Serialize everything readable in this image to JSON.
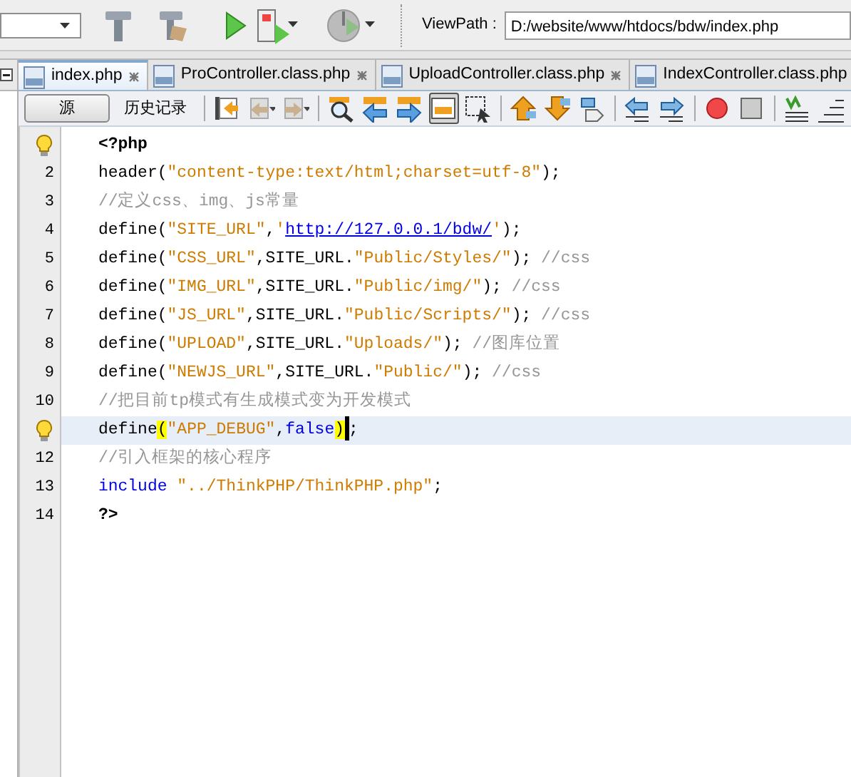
{
  "main_toolbar": {
    "viewpath_label": "ViewPath :",
    "viewpath_value": "D:/website/www/htdocs/bdw/index.php"
  },
  "tabs": [
    {
      "label": "index.php",
      "selected": true
    },
    {
      "label": "ProController.class.php",
      "selected": false
    },
    {
      "label": "UploadController.class.php",
      "selected": false
    },
    {
      "label": "IndexController.class.php",
      "selected": false
    }
  ],
  "editor_toolbar": {
    "views": [
      {
        "label": "源",
        "selected": true
      },
      {
        "label": "历史记录",
        "selected": false
      }
    ],
    "tools": [
      {
        "pressed": false
      },
      {
        "pressed": false
      },
      {
        "pressed": false
      },
      {
        "pressed": false
      },
      {
        "pressed": false
      },
      {
        "pressed": false
      },
      {
        "pressed": true
      },
      {
        "pressed": false
      },
      {
        "pressed": false
      },
      {
        "pressed": false
      },
      {
        "pressed": false
      },
      {
        "pressed": false
      },
      {
        "pressed": false
      },
      {
        "pressed": false
      },
      {
        "pressed": false
      },
      {
        "pressed": false
      },
      {
        "pressed": false
      }
    ]
  },
  "lines": [
    {
      "hint": true,
      "current": false,
      "tokens": [
        {
          "kind": "keyword",
          "text": "<?php"
        }
      ]
    },
    {
      "number": "2",
      "current": false,
      "tokens": [
        {
          "kind": "plain",
          "text": "header("
        },
        {
          "kind": "string",
          "text": "\"content-type:text/html;charset=utf-8\""
        },
        {
          "kind": "plain",
          "text": ");"
        }
      ]
    },
    {
      "number": "3",
      "current": false,
      "tokens": [
        {
          "kind": "comment",
          "text": "//定义css、img、js常量"
        }
      ]
    },
    {
      "number": "4",
      "current": false,
      "tokens": [
        {
          "kind": "plain",
          "text": "define("
        },
        {
          "kind": "string",
          "text": "\"SITE_URL\""
        },
        {
          "kind": "plain",
          "text": ","
        },
        {
          "kind": "string",
          "text": "'"
        },
        {
          "kind": "link",
          "text": "http://127.0.0.1/bdw/"
        },
        {
          "kind": "string",
          "text": "'"
        },
        {
          "kind": "plain",
          "text": ");"
        }
      ]
    },
    {
      "number": "5",
      "current": false,
      "tokens": [
        {
          "kind": "plain",
          "text": "define("
        },
        {
          "kind": "string",
          "text": "\"CSS_URL\""
        },
        {
          "kind": "plain",
          "text": ",SITE_URL."
        },
        {
          "kind": "string",
          "text": "\"Public/Styles/\""
        },
        {
          "kind": "plain",
          "text": "); "
        },
        {
          "kind": "comment",
          "text": "//css"
        }
      ]
    },
    {
      "number": "6",
      "current": false,
      "tokens": [
        {
          "kind": "plain",
          "text": "define("
        },
        {
          "kind": "string",
          "text": "\"IMG_URL\""
        },
        {
          "kind": "plain",
          "text": ",SITE_URL."
        },
        {
          "kind": "string",
          "text": "\"Public/img/\""
        },
        {
          "kind": "plain",
          "text": "); "
        },
        {
          "kind": "comment",
          "text": "//css"
        }
      ]
    },
    {
      "number": "7",
      "current": false,
      "tokens": [
        {
          "kind": "plain",
          "text": "define("
        },
        {
          "kind": "string",
          "text": "\"JS_URL\""
        },
        {
          "kind": "plain",
          "text": ",SITE_URL."
        },
        {
          "kind": "string",
          "text": "\"Public/Scripts/\""
        },
        {
          "kind": "plain",
          "text": "); "
        },
        {
          "kind": "comment",
          "text": "//css"
        }
      ]
    },
    {
      "number": "8",
      "current": false,
      "tokens": [
        {
          "kind": "plain",
          "text": "define("
        },
        {
          "kind": "string",
          "text": "\"UPLOAD\""
        },
        {
          "kind": "plain",
          "text": ",SITE_URL."
        },
        {
          "kind": "string",
          "text": "\"Uploads/\""
        },
        {
          "kind": "plain",
          "text": "); "
        },
        {
          "kind": "comment",
          "text": "//图库位置"
        }
      ]
    },
    {
      "number": "9",
      "current": false,
      "tokens": [
        {
          "kind": "plain",
          "text": "define("
        },
        {
          "kind": "string",
          "text": "\"NEWJS_URL\""
        },
        {
          "kind": "plain",
          "text": ",SITE_URL."
        },
        {
          "kind": "string",
          "text": "\"Public/\""
        },
        {
          "kind": "plain",
          "text": "); "
        },
        {
          "kind": "comment",
          "text": "//css"
        }
      ]
    },
    {
      "number": "10",
      "current": false,
      "tokens": [
        {
          "kind": "comment",
          "text": "//把目前tp模式有生成模式变为开发模式"
        }
      ]
    },
    {
      "hint": true,
      "current": true,
      "tokens": [
        {
          "kind": "plain",
          "text": "define"
        },
        {
          "kind": "match",
          "text": "("
        },
        {
          "kind": "string",
          "text": "\"APP_DEBUG\""
        },
        {
          "kind": "plain",
          "text": ","
        },
        {
          "kind": "literal",
          "text": "false"
        },
        {
          "kind": "match",
          "text": ")"
        },
        {
          "kind": "caret"
        },
        {
          "kind": "plain",
          "text": ";"
        }
      ]
    },
    {
      "number": "12",
      "current": false,
      "tokens": [
        {
          "kind": "comment",
          "text": "//引入框架的核心程序"
        }
      ]
    },
    {
      "number": "13",
      "current": false,
      "tokens": [
        {
          "kind": "literal",
          "text": "include"
        },
        {
          "kind": "string",
          "text": " \"../ThinkPHP/ThinkPHP.php\""
        },
        {
          "kind": "plain",
          "text": ";"
        }
      ]
    },
    {
      "number": "14",
      "current": false,
      "tokens": [
        {
          "kind": "keyword",
          "text": "?>"
        }
      ]
    }
  ]
}
